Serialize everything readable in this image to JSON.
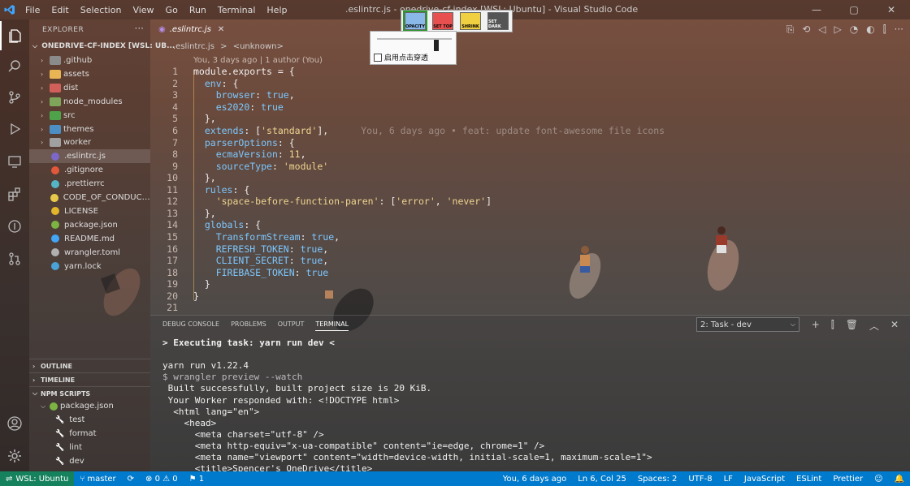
{
  "titlebar": {
    "menu": [
      "File",
      "Edit",
      "Selection",
      "View",
      "Go",
      "Run",
      "Terminal",
      "Help"
    ],
    "title": ".eslintrc.js - onedrive-cf-index [WSL: Ubuntu] - Visual Studio Code",
    "window_controls": [
      "—",
      "▢",
      "✕"
    ]
  },
  "opacity_tool": {
    "buttons": [
      "OPACITY",
      "SET TOP",
      "SHRINK",
      "SET DARK"
    ],
    "opacity_level_percent": 76,
    "checkbox_label": "启用点击穿透",
    "checkbox_checked": false
  },
  "sidebar": {
    "title": "EXPLORER",
    "root": "ONEDRIVE-CF-INDEX [WSL: UB...",
    "items": [
      {
        "label": ".github",
        "type": "folder",
        "icon": "folder-github-icon",
        "color": "#8b8b8b"
      },
      {
        "label": "assets",
        "type": "folder",
        "icon": "folder-icon",
        "color": "#e8b454"
      },
      {
        "label": "dist",
        "type": "folder",
        "icon": "folder-dist-icon",
        "color": "#d2605a"
      },
      {
        "label": "node_modules",
        "type": "folder",
        "icon": "folder-node-icon",
        "color": "#7ea55a"
      },
      {
        "label": "src",
        "type": "folder",
        "icon": "folder-src-icon",
        "color": "#4ea34a"
      },
      {
        "label": "themes",
        "type": "folder",
        "icon": "folder-themes-icon",
        "color": "#4d8ec4"
      },
      {
        "label": "worker",
        "type": "folder",
        "icon": "folder-icon",
        "color": "#a0a0a0"
      },
      {
        "label": ".eslintrc.js",
        "type": "file",
        "icon": "eslint-icon",
        "color": "#7b68c8"
      },
      {
        "label": ".gitignore",
        "type": "file",
        "icon": "git-icon",
        "color": "#e2583a"
      },
      {
        "label": ".prettierrc",
        "type": "file",
        "icon": "prettier-icon",
        "color": "#55b5c6"
      },
      {
        "label": "CODE_OF_CONDUCT....",
        "type": "file",
        "icon": "markdown-icon",
        "color": "#e8c84a"
      },
      {
        "label": "LICENSE",
        "type": "file",
        "icon": "license-icon",
        "color": "#e2b52a"
      },
      {
        "label": "package.json",
        "type": "file",
        "icon": "nodejs-icon",
        "color": "#7cb342"
      },
      {
        "label": "README.md",
        "type": "file",
        "icon": "info-icon",
        "color": "#42a5f5"
      },
      {
        "label": "wrangler.toml",
        "type": "file",
        "icon": "settings-icon",
        "color": "#b0b0b0"
      },
      {
        "label": "yarn.lock",
        "type": "file",
        "icon": "yarn-icon",
        "color": "#4aa3d8"
      }
    ],
    "sections": [
      "OUTLINE",
      "TIMELINE",
      "NPM SCRIPTS"
    ],
    "npm": {
      "package": "package.json",
      "scripts": [
        "test",
        "format",
        "lint",
        "dev"
      ]
    }
  },
  "editor": {
    "tab_label": ".eslintrc.js",
    "tab_close": "✕",
    "breadcrumb_file": ".eslintrc.js",
    "breadcrumb_sep": ">",
    "breadcrumb_symbol": "<unknown>",
    "blame_top": "You, 3 days ago | 1 author (You)",
    "inline_blame": "You, 6 days ago • feat: update font-awesome file icons",
    "lines": [
      {
        "n": "1",
        "indent": "",
        "parts": [
          [
            "module.exports = {",
            "p"
          ]
        ]
      },
      {
        "n": "2",
        "indent": "  ",
        "parts": [
          [
            "env",
            "b"
          ],
          [
            ": {",
            "p"
          ]
        ]
      },
      {
        "n": "3",
        "indent": "    ",
        "parts": [
          [
            "browser",
            "b"
          ],
          [
            ": ",
            "p"
          ],
          [
            "true",
            "b"
          ],
          [
            ",",
            "p"
          ]
        ]
      },
      {
        "n": "4",
        "indent": "    ",
        "parts": [
          [
            "es2020",
            "b"
          ],
          [
            ": ",
            "p"
          ],
          [
            "true",
            "b"
          ]
        ]
      },
      {
        "n": "5",
        "indent": "  ",
        "parts": [
          [
            "},",
            "p"
          ]
        ]
      },
      {
        "n": "6",
        "indent": "  ",
        "parts": [
          [
            "extends",
            "b"
          ],
          [
            ": [",
            "p"
          ],
          [
            "'standard'",
            "s"
          ],
          [
            "],",
            "p"
          ]
        ]
      },
      {
        "n": "7",
        "indent": "  ",
        "parts": [
          [
            "parserOptions",
            "b"
          ],
          [
            ": {",
            "p"
          ]
        ]
      },
      {
        "n": "8",
        "indent": "    ",
        "parts": [
          [
            "ecmaVersion",
            "b"
          ],
          [
            ": ",
            "p"
          ],
          [
            "11",
            "s"
          ],
          [
            ",",
            "p"
          ]
        ]
      },
      {
        "n": "9",
        "indent": "    ",
        "parts": [
          [
            "sourceType",
            "b"
          ],
          [
            ": ",
            "p"
          ],
          [
            "'module'",
            "s"
          ]
        ]
      },
      {
        "n": "10",
        "indent": "  ",
        "parts": [
          [
            "},",
            "p"
          ]
        ]
      },
      {
        "n": "11",
        "indent": "  ",
        "parts": [
          [
            "rules",
            "b"
          ],
          [
            ": {",
            "p"
          ]
        ]
      },
      {
        "n": "12",
        "indent": "    ",
        "parts": [
          [
            "'space-before-function-paren'",
            "s"
          ],
          [
            ": [",
            "p"
          ],
          [
            "'error'",
            "s"
          ],
          [
            ", ",
            "p"
          ],
          [
            "'never'",
            "s"
          ],
          [
            "]",
            "p"
          ]
        ]
      },
      {
        "n": "13",
        "indent": "  ",
        "parts": [
          [
            "},",
            "p"
          ]
        ]
      },
      {
        "n": "14",
        "indent": "  ",
        "parts": [
          [
            "globals",
            "b"
          ],
          [
            ": {",
            "p"
          ]
        ]
      },
      {
        "n": "15",
        "indent": "    ",
        "parts": [
          [
            "TransformStream",
            "b"
          ],
          [
            ": ",
            "p"
          ],
          [
            "true",
            "b"
          ],
          [
            ",",
            "p"
          ]
        ]
      },
      {
        "n": "16",
        "indent": "    ",
        "parts": [
          [
            "REFRESH_TOKEN",
            "b"
          ],
          [
            ": ",
            "p"
          ],
          [
            "true",
            "b"
          ],
          [
            ",",
            "p"
          ]
        ]
      },
      {
        "n": "17",
        "indent": "    ",
        "parts": [
          [
            "CLIENT_SECRET",
            "b"
          ],
          [
            ": ",
            "p"
          ],
          [
            "true",
            "b"
          ],
          [
            ",",
            "p"
          ]
        ]
      },
      {
        "n": "18",
        "indent": "    ",
        "parts": [
          [
            "FIREBASE_TOKEN",
            "b"
          ],
          [
            ": ",
            "p"
          ],
          [
            "true",
            "b"
          ]
        ]
      },
      {
        "n": "19",
        "indent": "  ",
        "parts": [
          [
            "}",
            "p"
          ]
        ]
      },
      {
        "n": "20",
        "indent": "",
        "parts": [
          [
            "}",
            "p"
          ]
        ]
      },
      {
        "n": "21",
        "indent": "",
        "parts": []
      }
    ]
  },
  "panel": {
    "tabs": [
      "DEBUG CONSOLE",
      "PROBLEMS",
      "OUTPUT",
      "TERMINAL"
    ],
    "active_tab": "TERMINAL",
    "task_select": "2: Task - dev",
    "task_select_arrow": "⌵",
    "actions": [
      "+",
      "⫿",
      "🗑",
      "︿",
      "✕"
    ],
    "terminal_lines": [
      "> Executing task: yarn run dev <",
      "",
      "yarn run v1.22.4",
      "$ wrangler preview --watch",
      " Built successfully, built project size is 20 KiB.",
      " Your Worker responded with: <!DOCTYPE html>",
      "  <html lang=\"en\">",
      "    <head>",
      "      <meta charset=\"utf-8\" />",
      "      <meta http-equiv=\"x-ua-compatible\" content=\"ie=edge, chrome=1\" />",
      "      <meta name=\"viewport\" content=\"width=device-width, initial-scale=1, maximum-scale=1\">",
      "      <title>Spencer's OneDrive</title>"
    ]
  },
  "statusbar": {
    "remote": "WSL: Ubuntu",
    "branch": "master",
    "sync": "⟳",
    "errors_warnings": "⊗ 0 ⚠ 0",
    "live": "⚑ 1",
    "blame": "You, 6 days ago",
    "position": "Ln 6, Col 25",
    "spaces": "Spaces: 2",
    "encoding": "UTF-8",
    "eol": "LF",
    "language": "JavaScript",
    "eslint": "ESLint",
    "prettier": "Prettier",
    "feedback": "☺",
    "bell": "🔔"
  },
  "colors": {
    "statusbar": "#007acc",
    "remote": "#16825d",
    "accent_blue": "#7cc8ff",
    "string": "#f0d590"
  }
}
